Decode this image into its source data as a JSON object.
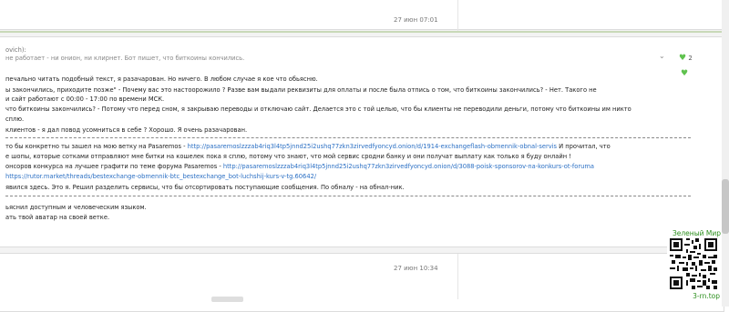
{
  "posts": {
    "top": {
      "date": "27 июн 07:01"
    },
    "main": {
      "quote_author": "ovich):",
      "quote_text": "не работает - ни онион, ни клирнет. Бот пишет, что биткоины кончились.",
      "like_count": "2",
      "lines": [
        "печально читать подобный текст, я разачарован. Но ничего. В любом случае я кое что обьясню.",
        "ы закончились, приходите позже\" - Почему вас это настоорожило ? Разве вам выдали реквизиты для оплаты и после была отпись о том, что биткоины закончились? - Нет. Такого не",
        "и сайт работают с 00:00 - 17:00 по времени МСК.",
        " что биткоины закончились? - Потому что перед сном, я закрываю переводы и отключаю сайт. Делается это с той целью, что бы клиенты не переводили деньги, потому что биткоины им никто",
        "сплю.",
        "клиентов - я дал повод усомниться в себе ? Хорошо. Я очень разачарован."
      ],
      "line_b1_pre": "то бы конкретно ты зашел на мою ветку на Pasaremos - ",
      "line_b1_link": "http://pasaremoslzzzab4riq3l4tp5jnnd25i2ushq77zkn3zirvedfyoncyd.onion/d/1914-exchangeflash-obmennik-obnal-servis",
      "line_b1_post": " И прочитал, что",
      "line_b2": "е шопы, которые сотками отправляют мне битки на кошелек пока я сплю, потому что знают, что мой сервис сродни банку и они получат выплату как только я буду онлайн !",
      "line_b3_pre": "онсоров конкурса на лучшее графити по теме форума Pasaremos - ",
      "line_b3_link": "http://pasaremoslzzzab4riq3l4tp5jnnd25i2ushq77zkn3zirvedfyoncyd.onion/d/3088-poisk-sponsorov-na-konkurs-ot-foruma",
      "line_b4_link": "https://rutor.market/threads/bestexchange-obmennik-btc_bestexchange_bot-luchshij-kurs-v-tg.60642/",
      "line_b5": "явился здесь. Это я. Решил разделить сервисы, что бы отсортировать поступающие сообщения. По обналу - на обнал-ник.",
      "line_c1": "ьяснил доступным и человеческим языком.",
      "line_c2": "ать твой аватар на своей ветке."
    },
    "bottom": {
      "date": "27 июн 10:34"
    }
  },
  "watermark": {
    "title": "Зеленый Мир",
    "footer": "3-rn.top"
  },
  "colors": {
    "link": "#2a6fc4",
    "heart": "#5fc24e",
    "watermark_text": "#2b8f1c"
  }
}
